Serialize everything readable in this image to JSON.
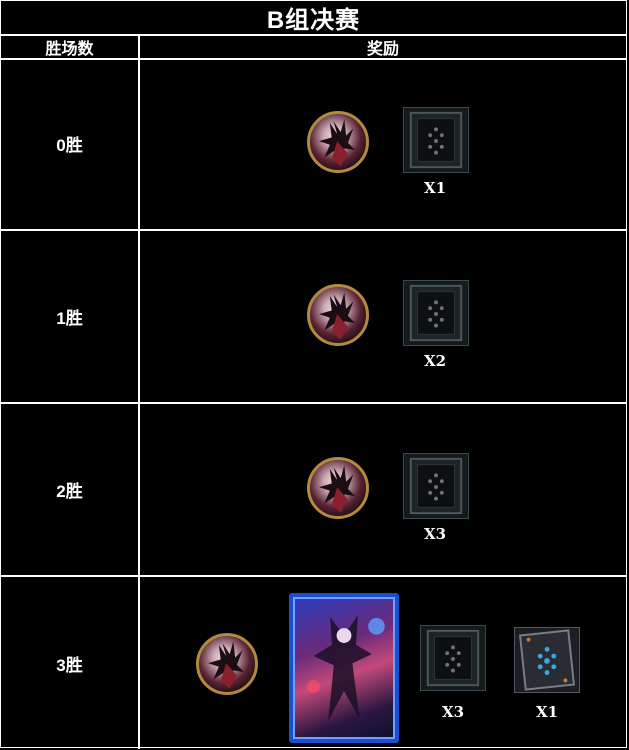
{
  "title": "B组决赛",
  "headers": {
    "wins": "胜场数",
    "rewards": "奖励"
  },
  "rows": [
    {
      "wins": "0胜",
      "rewards": [
        {
          "type": "avatar",
          "icon": "avatar-icon"
        },
        {
          "type": "card-pack",
          "icon": "card-pack-icon",
          "qty": "X1"
        }
      ]
    },
    {
      "wins": "1胜",
      "rewards": [
        {
          "type": "avatar",
          "icon": "avatar-icon"
        },
        {
          "type": "card-pack",
          "icon": "card-pack-icon",
          "qty": "X2"
        }
      ]
    },
    {
      "wins": "2胜",
      "rewards": [
        {
          "type": "avatar",
          "icon": "avatar-icon"
        },
        {
          "type": "card-pack",
          "icon": "card-pack-icon",
          "qty": "X3"
        }
      ]
    },
    {
      "wins": "3胜",
      "rewards": [
        {
          "type": "avatar",
          "icon": "avatar-icon"
        },
        {
          "type": "legendary-card",
          "icon": "legendary-card-icon"
        },
        {
          "type": "card-pack",
          "icon": "card-pack-icon",
          "qty": "X3"
        },
        {
          "type": "special-card-pack",
          "icon": "special-card-pack-icon",
          "qty": "X1"
        }
      ]
    }
  ],
  "colors": {
    "background": "#000000",
    "grid": "#ffffff",
    "avatar_ring": "#b08a3e",
    "card_frame": "#1a4fd0"
  }
}
